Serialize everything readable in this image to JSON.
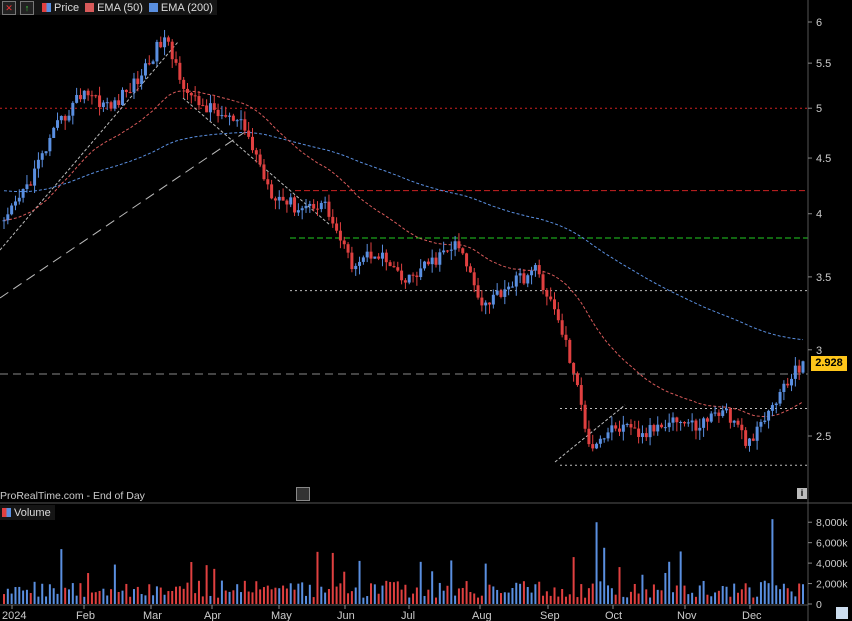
{
  "legend": {
    "price_label": "Price",
    "ema50_label": "EMA (50)",
    "ema200_label": "EMA (200)"
  },
  "volume_label": "Volume",
  "footer": "ProRealTime.com - End of Day",
  "last_price_label": "2.928",
  "colors": {
    "background": "#000000",
    "up": "#5a8fe0",
    "down": "#e04040",
    "ema50": "#d85a5a",
    "ema200": "#5a8fe0",
    "support": "#22cc22",
    "last_price": "#ffc61a"
  },
  "chart_data": [
    {
      "type": "candlestick",
      "title": "",
      "x_axis_labels": [
        "2024",
        "Feb",
        "Mar",
        "Apr",
        "May",
        "Jun",
        "Jul",
        "Aug",
        "Sep",
        "Oct",
        "Nov",
        "Dec"
      ],
      "y_axis_ticks": [
        2.5,
        3,
        3.5,
        4,
        4.5,
        5,
        5.5,
        6
      ],
      "ylim": [
        2.25,
        6.1
      ],
      "y_scale": "log",
      "last_price": 2.928,
      "close_path": [
        {
          "month": "Jan",
          "value": 3.9
        },
        {
          "month": "Jan",
          "value": 4.3
        },
        {
          "month": "Jan",
          "value": 4.8
        },
        {
          "month": "Feb",
          "value": 5.2
        },
        {
          "month": "Feb",
          "value": 5.0
        },
        {
          "month": "Feb",
          "value": 5.3
        },
        {
          "month": "Mar",
          "value": 5.8
        },
        {
          "month": "Mar",
          "value": 5.1
        },
        {
          "month": "Mar",
          "value": 4.95
        },
        {
          "month": "Apr",
          "value": 4.8
        },
        {
          "month": "Apr",
          "value": 4.2
        },
        {
          "month": "May",
          "value": 4.05
        },
        {
          "month": "May",
          "value": 4.1
        },
        {
          "month": "Jun",
          "value": 3.6
        },
        {
          "month": "Jun",
          "value": 3.7
        },
        {
          "month": "Jul",
          "value": 3.45
        },
        {
          "month": "Jul",
          "value": 3.6
        },
        {
          "month": "Jul",
          "value": 3.75
        },
        {
          "month": "Aug",
          "value": 3.3
        },
        {
          "month": "Aug",
          "value": 3.45
        },
        {
          "month": "Aug",
          "value": 3.55
        },
        {
          "month": "Sep",
          "value": 3.1
        },
        {
          "month": "Sep",
          "value": 2.45
        },
        {
          "month": "Sep",
          "value": 2.55
        },
        {
          "month": "Oct",
          "value": 2.5
        },
        {
          "month": "Oct",
          "value": 2.6
        },
        {
          "month": "Nov",
          "value": 2.55
        },
        {
          "month": "Nov",
          "value": 2.65
        },
        {
          "month": "Nov",
          "value": 2.45
        },
        {
          "month": "Dec",
          "value": 2.7
        },
        {
          "month": "Dec",
          "value": 2.928
        }
      ],
      "horizontal_levels": [
        {
          "value": 5.0,
          "style": "dotted",
          "color": "#cc2222"
        },
        {
          "value": 4.2,
          "style": "dashed",
          "color": "#cc2222"
        },
        {
          "value": 3.8,
          "style": "dashed",
          "color": "#22cc22"
        },
        {
          "value": 3.4,
          "style": "dotted",
          "color": "#bbbbbb"
        },
        {
          "value": 2.85,
          "style": "dashed",
          "color": "#888888"
        },
        {
          "value": 2.65,
          "style": "dotted",
          "color": "#bbbbbb"
        },
        {
          "value": 2.35,
          "style": "dotted",
          "color": "#bbbbbb"
        }
      ],
      "series": [
        {
          "name": "EMA (50)",
          "color": "#d85a5a",
          "style": "dashed"
        },
        {
          "name": "EMA (200)",
          "color": "#5a8fe0",
          "style": "dashed"
        }
      ]
    },
    {
      "type": "bar",
      "title": "Volume",
      "y_axis_ticks_labels": [
        "0",
        "2,000k",
        "4,000k",
        "6,000k",
        "8,000k"
      ],
      "y_axis_ticks": [
        0,
        2000,
        4000,
        6000,
        8000
      ],
      "ylim": [
        0,
        9000
      ],
      "unit": "k"
    }
  ]
}
